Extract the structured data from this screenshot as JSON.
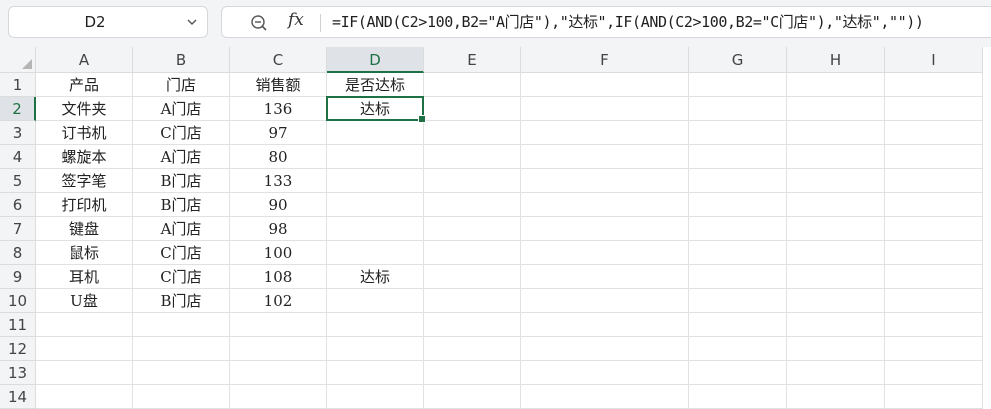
{
  "name_box": {
    "ref": "D2"
  },
  "formula_bar": {
    "fx": "fx",
    "formula": "=IF(AND(C2>100,B2=\"A门店\"),\"达标\",IF(AND(C2>100,B2=\"C门店\"),\"达标\",\"\"))"
  },
  "columns": [
    "A",
    "B",
    "C",
    "D",
    "E",
    "F",
    "G",
    "H",
    "I"
  ],
  "rows": [
    "1",
    "2",
    "3",
    "4",
    "5",
    "6",
    "7",
    "8",
    "9",
    "10",
    "11",
    "12",
    "13",
    "14"
  ],
  "cells": [
    [
      "产品",
      "门店",
      "销售额",
      "是否达标"
    ],
    [
      "文件夹",
      "A门店",
      "136",
      "达标"
    ],
    [
      "订书机",
      "C门店",
      "97",
      ""
    ],
    [
      "螺旋本",
      "A门店",
      "80",
      ""
    ],
    [
      "签字笔",
      "B门店",
      "133",
      ""
    ],
    [
      "打印机",
      "B门店",
      "90",
      ""
    ],
    [
      "键盘",
      "A门店",
      "98",
      ""
    ],
    [
      "鼠标",
      "C门店",
      "100",
      ""
    ],
    [
      "耳机",
      "C门店",
      "108",
      "达标"
    ],
    [
      "U盘",
      "B门店",
      "102",
      ""
    ]
  ],
  "selected": {
    "column": "D",
    "row": "2"
  },
  "colors": {
    "accent": "#1e7145",
    "header_bg": "#f3f4f6"
  }
}
